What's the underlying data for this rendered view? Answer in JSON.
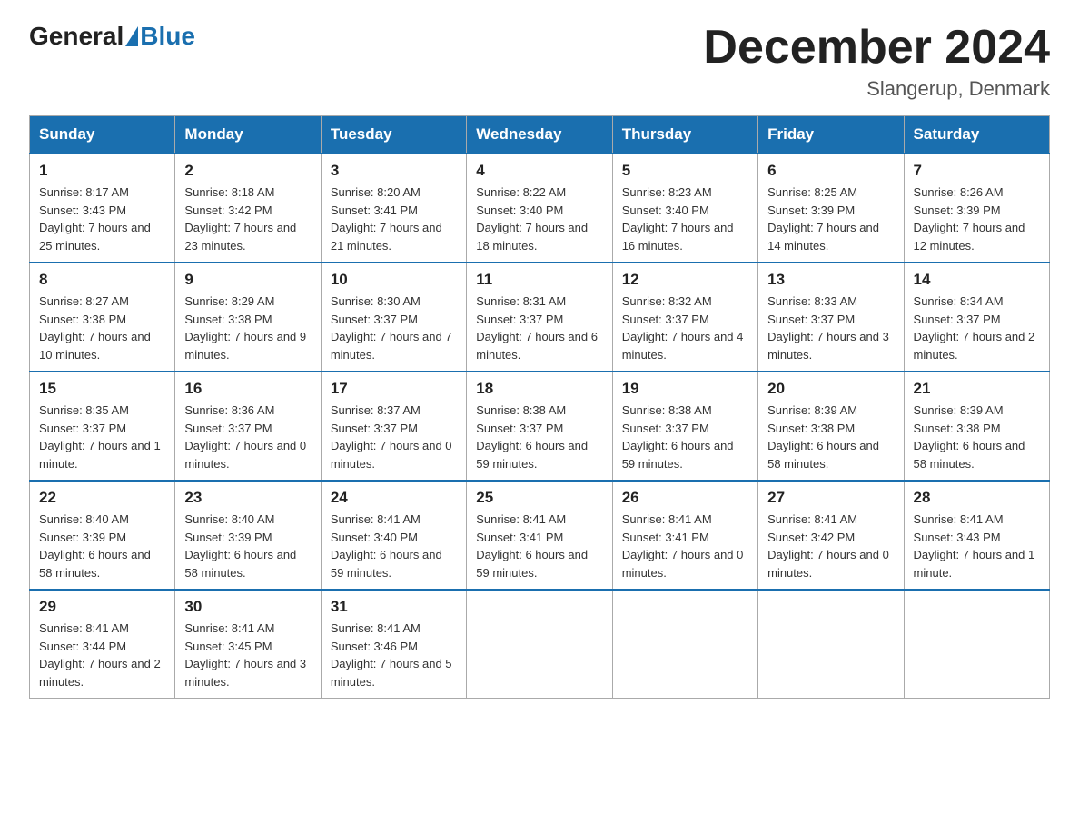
{
  "header": {
    "logo_general": "General",
    "logo_blue": "Blue",
    "month_title": "December 2024",
    "location": "Slangerup, Denmark"
  },
  "weekdays": [
    "Sunday",
    "Monday",
    "Tuesday",
    "Wednesday",
    "Thursday",
    "Friday",
    "Saturday"
  ],
  "weeks": [
    [
      {
        "day": "1",
        "sunrise": "8:17 AM",
        "sunset": "3:43 PM",
        "daylight": "7 hours and 25 minutes."
      },
      {
        "day": "2",
        "sunrise": "8:18 AM",
        "sunset": "3:42 PM",
        "daylight": "7 hours and 23 minutes."
      },
      {
        "day": "3",
        "sunrise": "8:20 AM",
        "sunset": "3:41 PM",
        "daylight": "7 hours and 21 minutes."
      },
      {
        "day": "4",
        "sunrise": "8:22 AM",
        "sunset": "3:40 PM",
        "daylight": "7 hours and 18 minutes."
      },
      {
        "day": "5",
        "sunrise": "8:23 AM",
        "sunset": "3:40 PM",
        "daylight": "7 hours and 16 minutes."
      },
      {
        "day": "6",
        "sunrise": "8:25 AM",
        "sunset": "3:39 PM",
        "daylight": "7 hours and 14 minutes."
      },
      {
        "day": "7",
        "sunrise": "8:26 AM",
        "sunset": "3:39 PM",
        "daylight": "7 hours and 12 minutes."
      }
    ],
    [
      {
        "day": "8",
        "sunrise": "8:27 AM",
        "sunset": "3:38 PM",
        "daylight": "7 hours and 10 minutes."
      },
      {
        "day": "9",
        "sunrise": "8:29 AM",
        "sunset": "3:38 PM",
        "daylight": "7 hours and 9 minutes."
      },
      {
        "day": "10",
        "sunrise": "8:30 AM",
        "sunset": "3:37 PM",
        "daylight": "7 hours and 7 minutes."
      },
      {
        "day": "11",
        "sunrise": "8:31 AM",
        "sunset": "3:37 PM",
        "daylight": "7 hours and 6 minutes."
      },
      {
        "day": "12",
        "sunrise": "8:32 AM",
        "sunset": "3:37 PM",
        "daylight": "7 hours and 4 minutes."
      },
      {
        "day": "13",
        "sunrise": "8:33 AM",
        "sunset": "3:37 PM",
        "daylight": "7 hours and 3 minutes."
      },
      {
        "day": "14",
        "sunrise": "8:34 AM",
        "sunset": "3:37 PM",
        "daylight": "7 hours and 2 minutes."
      }
    ],
    [
      {
        "day": "15",
        "sunrise": "8:35 AM",
        "sunset": "3:37 PM",
        "daylight": "7 hours and 1 minute."
      },
      {
        "day": "16",
        "sunrise": "8:36 AM",
        "sunset": "3:37 PM",
        "daylight": "7 hours and 0 minutes."
      },
      {
        "day": "17",
        "sunrise": "8:37 AM",
        "sunset": "3:37 PM",
        "daylight": "7 hours and 0 minutes."
      },
      {
        "day": "18",
        "sunrise": "8:38 AM",
        "sunset": "3:37 PM",
        "daylight": "6 hours and 59 minutes."
      },
      {
        "day": "19",
        "sunrise": "8:38 AM",
        "sunset": "3:37 PM",
        "daylight": "6 hours and 59 minutes."
      },
      {
        "day": "20",
        "sunrise": "8:39 AM",
        "sunset": "3:38 PM",
        "daylight": "6 hours and 58 minutes."
      },
      {
        "day": "21",
        "sunrise": "8:39 AM",
        "sunset": "3:38 PM",
        "daylight": "6 hours and 58 minutes."
      }
    ],
    [
      {
        "day": "22",
        "sunrise": "8:40 AM",
        "sunset": "3:39 PM",
        "daylight": "6 hours and 58 minutes."
      },
      {
        "day": "23",
        "sunrise": "8:40 AM",
        "sunset": "3:39 PM",
        "daylight": "6 hours and 58 minutes."
      },
      {
        "day": "24",
        "sunrise": "8:41 AM",
        "sunset": "3:40 PM",
        "daylight": "6 hours and 59 minutes."
      },
      {
        "day": "25",
        "sunrise": "8:41 AM",
        "sunset": "3:41 PM",
        "daylight": "6 hours and 59 minutes."
      },
      {
        "day": "26",
        "sunrise": "8:41 AM",
        "sunset": "3:41 PM",
        "daylight": "7 hours and 0 minutes."
      },
      {
        "day": "27",
        "sunrise": "8:41 AM",
        "sunset": "3:42 PM",
        "daylight": "7 hours and 0 minutes."
      },
      {
        "day": "28",
        "sunrise": "8:41 AM",
        "sunset": "3:43 PM",
        "daylight": "7 hours and 1 minute."
      }
    ],
    [
      {
        "day": "29",
        "sunrise": "8:41 AM",
        "sunset": "3:44 PM",
        "daylight": "7 hours and 2 minutes."
      },
      {
        "day": "30",
        "sunrise": "8:41 AM",
        "sunset": "3:45 PM",
        "daylight": "7 hours and 3 minutes."
      },
      {
        "day": "31",
        "sunrise": "8:41 AM",
        "sunset": "3:46 PM",
        "daylight": "7 hours and 5 minutes."
      },
      null,
      null,
      null,
      null
    ]
  ],
  "labels": {
    "sunrise": "Sunrise:",
    "sunset": "Sunset:",
    "daylight": "Daylight:"
  }
}
